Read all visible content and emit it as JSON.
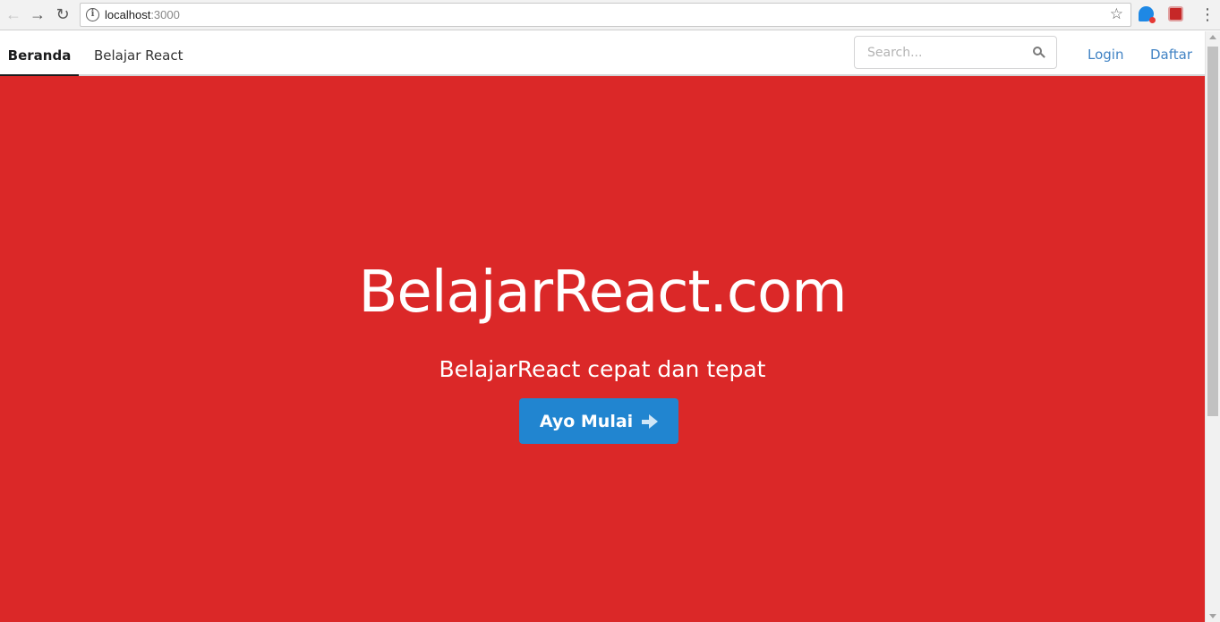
{
  "browser": {
    "url_host": "localhost",
    "url_port": ":3000"
  },
  "menu": {
    "items": [
      {
        "label": "Beranda",
        "active": true
      },
      {
        "label": "Belajar React",
        "active": false
      }
    ],
    "search_placeholder": "Search...",
    "login_label": "Login",
    "daftar_label": "Daftar"
  },
  "hero": {
    "title": "BelajarReact.com",
    "subtitle": "BelajarReact cepat dan tepat",
    "cta_label": "Ayo Mulai"
  },
  "colors": {
    "hero_background": "#db2828",
    "primary_button": "#2185d0",
    "link": "#4183c4"
  }
}
